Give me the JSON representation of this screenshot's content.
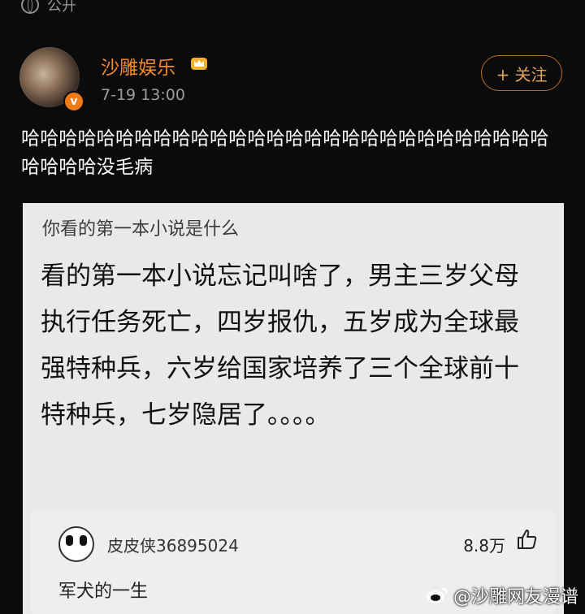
{
  "topbar": {
    "visibility_icon": "globe-icon",
    "visibility_label": "公开"
  },
  "post": {
    "author": "沙雕娱乐",
    "verified_icon": "verified-v-icon",
    "badge_icon": "crown-icon",
    "timestamp": "7-19 13:00",
    "follow_label": "+ 关注",
    "body": "哈哈哈哈哈哈哈哈哈哈哈哈哈哈哈哈哈哈哈哈哈哈哈哈哈哈哈哈哈哈哈哈没毛病"
  },
  "card": {
    "question": "你看的第一本小说是什么",
    "answer": "看的第一本小说忘记叫啥了，男主三岁父母执行任务死亡，四岁报仇，五岁成为全球最强特种兵，六岁给国家培养了三个全球前十特种兵，七岁隐居了。。。。",
    "comment": {
      "user": "皮皮侠36895024",
      "likes": "8.8万",
      "text": "军犬的一生"
    }
  },
  "watermark": {
    "icon": "weibo-icon",
    "text": "@沙雕网友漫谱"
  },
  "colors": {
    "accent": "#f08a2a",
    "background": "#0b0b0c",
    "card": "#e9e9ea"
  }
}
